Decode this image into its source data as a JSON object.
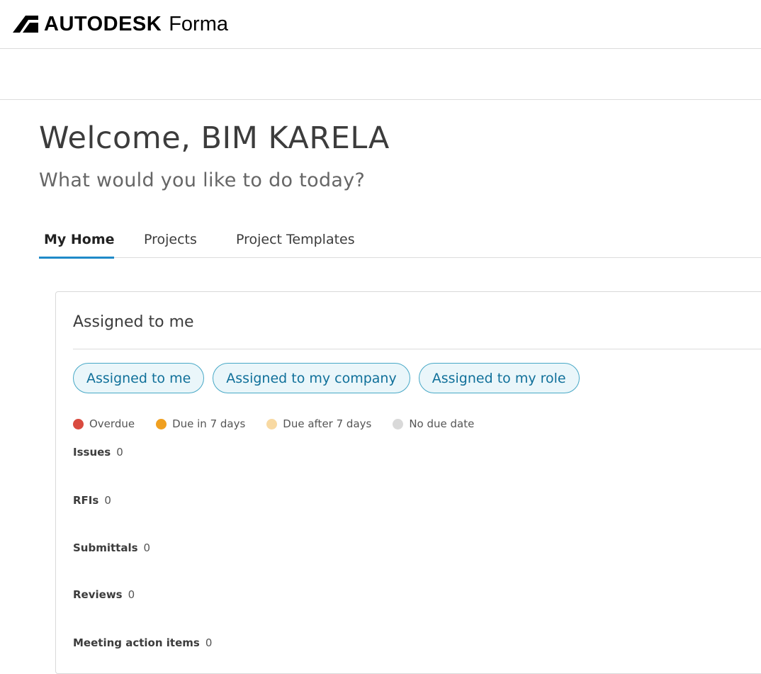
{
  "header": {
    "brand": "AUTODESK",
    "product": "Forma"
  },
  "welcome": {
    "title": "Welcome, BIM KARELA",
    "subtitle": "What would you like to do today?"
  },
  "tabs": [
    {
      "label": "My Home",
      "active": true
    },
    {
      "label": "Projects",
      "active": false
    },
    {
      "label": "Project Templates",
      "active": false
    }
  ],
  "card": {
    "title": "Assigned to me",
    "filters": [
      {
        "label": "Assigned to me"
      },
      {
        "label": "Assigned to my company"
      },
      {
        "label": "Assigned to my role"
      }
    ],
    "legend": [
      {
        "label": "Overdue",
        "color": "#d94a3f"
      },
      {
        "label": "Due in 7 days",
        "color": "#f0a020"
      },
      {
        "label": "Due after 7 days",
        "color": "#f8d9a2"
      },
      {
        "label": "No due date",
        "color": "#d9d9d9"
      }
    ],
    "rows": [
      {
        "label": "Issues",
        "count": "0"
      },
      {
        "label": "RFIs",
        "count": "0"
      },
      {
        "label": "Submittals",
        "count": "0"
      },
      {
        "label": "Reviews",
        "count": "0"
      },
      {
        "label": "Meeting action items",
        "count": "0"
      }
    ]
  }
}
